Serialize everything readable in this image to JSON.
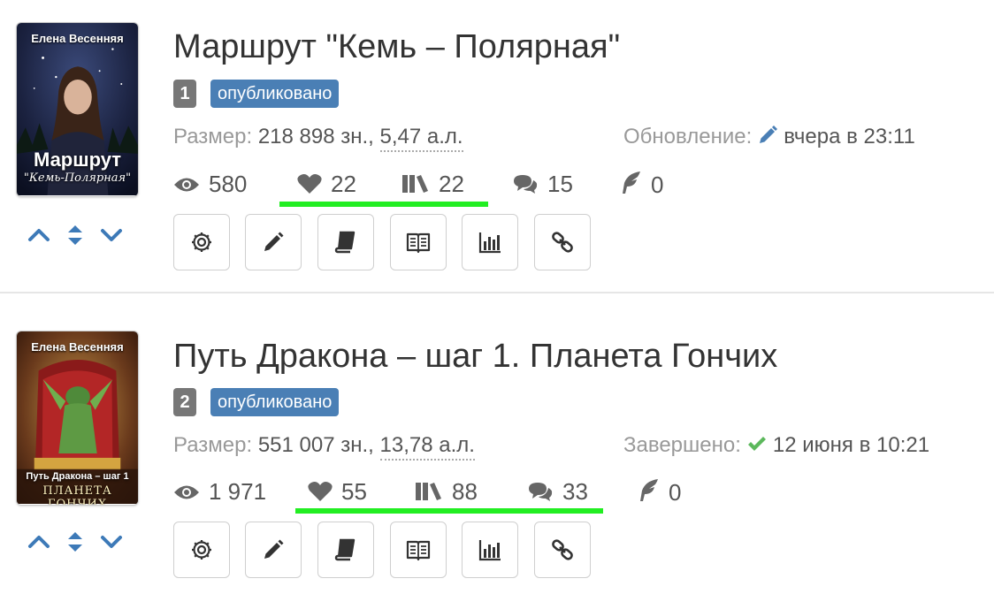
{
  "books": [
    {
      "cover": {
        "author": "Елена Весенняя",
        "title": "Маршрут",
        "subtitle": "\"Кемь-Полярная\""
      },
      "title": "Маршрут \"Кемь – Полярная\"",
      "number": "1",
      "status": "опубликовано",
      "size_label": "Размер:",
      "size_chars": "218 898 зн.,",
      "size_al": "5,47 а.л.",
      "date_label": "Обновление:",
      "date_icon": "pencil-icon",
      "date_value": "вчера в 23:11",
      "stats": {
        "views": "580",
        "likes": "22",
        "libraries": "22",
        "comments": "15",
        "reviews": "0"
      }
    },
    {
      "cover": {
        "author": "Елена Весенняя",
        "title": "Путь Дракона – шаг 1",
        "subtitle": "ПЛАНЕТА ГОНЧИХ"
      },
      "title": "Путь Дракона – шаг 1. Планета Гончих",
      "number": "2",
      "status": "опубликовано",
      "size_label": "Размер:",
      "size_chars": "551 007 зн.,",
      "size_al": "13,78 а.л.",
      "date_label": "Завершено:",
      "date_icon": "check-icon",
      "date_value": "12 июня в 10:21",
      "stats": {
        "views": "1 971",
        "likes": "55",
        "libraries": "88",
        "comments": "33",
        "reviews": "0"
      }
    }
  ],
  "colors": {
    "status_badge": "#4a7fb5",
    "number_badge": "#777777",
    "highlight_line": "#22ee22",
    "arrow_blue": "#3d7ab8",
    "check_green": "#5cb85c"
  },
  "tool_icons": [
    "gear-icon",
    "pencil-icon",
    "book-icon",
    "open-book-icon",
    "bar-chart-icon",
    "link-icon"
  ]
}
